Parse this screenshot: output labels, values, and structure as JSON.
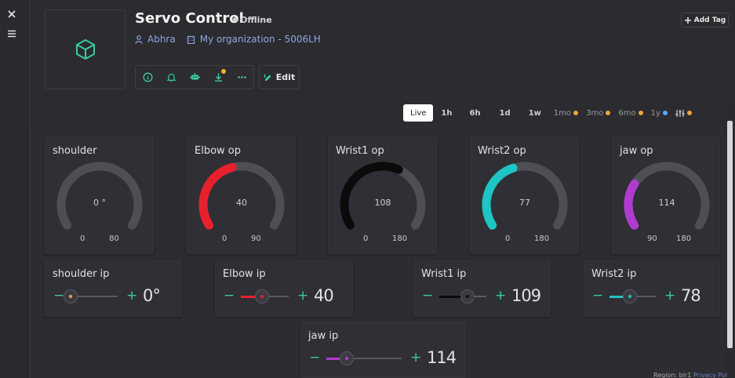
{
  "sidebar": {
    "close_icon": "close-icon",
    "menu_icon": "hamburger-icon"
  },
  "device": {
    "title": "Servo Control",
    "status": "Offline",
    "owner": "Abhra",
    "organization": "My organization - 5006LH",
    "add_tag_label": "Add Tag",
    "edit_label": "Edit"
  },
  "toolbar_icons": [
    "info-icon",
    "bell-icon",
    "robot-icon",
    "download-icon",
    "more-icon"
  ],
  "time_ranges": [
    {
      "label": "Live",
      "active": true,
      "dot": null
    },
    {
      "label": "1h",
      "active": false,
      "dot": null
    },
    {
      "label": "6h",
      "active": false,
      "dot": null
    },
    {
      "label": "1d",
      "active": false,
      "dot": null
    },
    {
      "label": "1w",
      "active": false,
      "dot": null
    },
    {
      "label": "1mo",
      "active": false,
      "dot": "orange"
    },
    {
      "label": "3mo",
      "active": false,
      "dot": "orange"
    },
    {
      "label": "6mo",
      "active": false,
      "dot": "orange"
    },
    {
      "label": "1y",
      "active": false,
      "dot": "blue"
    },
    {
      "label": "",
      "active": false,
      "dot": "orange"
    }
  ],
  "gauges": [
    {
      "title": "shoulder",
      "value": "0",
      "unit": "°",
      "min": "0",
      "max": "80",
      "fraction": 0.0,
      "color": "#e02030"
    },
    {
      "title": "Elbow op",
      "value": "40",
      "unit": "",
      "min": "0",
      "max": "90",
      "fraction": 0.444,
      "color": "#e8202e"
    },
    {
      "title": "Wrist1 op",
      "value": "108",
      "unit": "",
      "min": "0",
      "max": "180",
      "fraction": 0.6,
      "color": "#0b0b0b"
    },
    {
      "title": "Wrist2 op",
      "value": "77",
      "unit": "",
      "min": "0",
      "max": "180",
      "fraction": 0.428,
      "color": "#1fc4c4"
    },
    {
      "title": "jaw op",
      "value": "114",
      "unit": "",
      "min": "90",
      "max": "180",
      "fraction": 0.267,
      "color": "#b03ccf"
    }
  ],
  "sliders": [
    {
      "title": "shoulder ip",
      "value": "0",
      "unit": "°",
      "fraction": 0.0,
      "color": "#f0a23a"
    },
    {
      "title": "Elbow ip",
      "value": "40",
      "unit": "",
      "fraction": 0.444,
      "color": "#e8202e"
    },
    {
      "title": "Wrist1 ip",
      "value": "109",
      "unit": "",
      "fraction": 0.606,
      "color": "#0b0b0b"
    },
    {
      "title": "Wrist2 ip",
      "value": "78",
      "unit": "",
      "fraction": 0.433,
      "color": "#1fc4c4"
    },
    {
      "title": "jaw ip",
      "value": "114",
      "unit": "",
      "fraction": 0.267,
      "color": "#b03ccf"
    }
  ],
  "footer": {
    "text": "Region: blr1",
    "link1": "Privacy Pol"
  }
}
